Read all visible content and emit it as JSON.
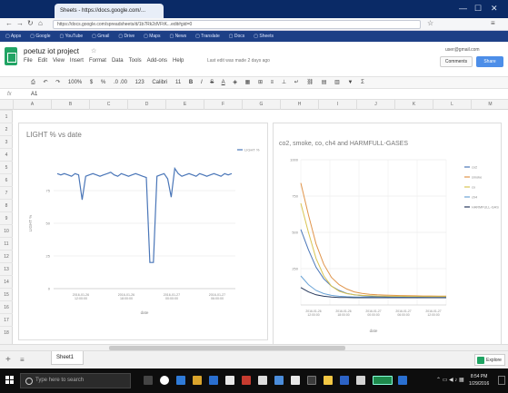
{
  "browser": {
    "tab_title": "Sheets - https://docs.google.com/...",
    "url": "https://docs.google.com/spreadsheets/d/1b7Rk2dVFtK...edit#gid=0",
    "bookmarks": [
      "Apps",
      "Google",
      "YouTube",
      "Gmail",
      "Drive",
      "Maps",
      "News",
      "Translate",
      "Docs",
      "Sheets"
    ],
    "window_controls": [
      "—",
      "☐",
      "✕"
    ]
  },
  "sheets": {
    "doc_title": "poetuz iot project",
    "star_icon": "star-icon",
    "menu": [
      "File",
      "Edit",
      "View",
      "Insert",
      "Format",
      "Data",
      "Tools",
      "Add-ons",
      "Help"
    ],
    "last_edit": "Last edit was made 2 days ago",
    "account": "user@gmail.com",
    "comments_label": "Comments",
    "share_label": "Share",
    "toolbar": {
      "zoom": "100%",
      "currency": "$",
      "percent": "%",
      "decimals": ".0  .00",
      "number_format": "123",
      "font": "Calibri",
      "font_size": "11",
      "bold": "B",
      "italic": "I",
      "strike": "S",
      "text_color": "A"
    },
    "fx_label": "fx",
    "cell_ref": "A1",
    "columns": [
      "A",
      "B",
      "C",
      "D",
      "E",
      "F",
      "G",
      "H",
      "I",
      "J",
      "K",
      "L",
      "M"
    ],
    "rows": [
      "1",
      "2",
      "3",
      "4",
      "5",
      "6",
      "7",
      "8",
      "9",
      "10",
      "11",
      "12",
      "13",
      "14",
      "15",
      "16",
      "17",
      "18"
    ],
    "sheet_tab": "Sheet1",
    "explore_label": "Explore",
    "add_sheet_icon": "plus-icon",
    "list_sheets_icon": "menu-icon"
  },
  "chart_data": [
    {
      "type": "line",
      "title": "LIGHT % vs date",
      "xlabel": "date",
      "ylabel": "LIGHT %",
      "legend": [
        "LIGHT %"
      ],
      "legend_position": "right",
      "yticks": [
        "75",
        "50",
        "25",
        "0"
      ],
      "ylim": [
        0,
        100
      ],
      "xticks": [
        "2016-01-26 12:00:00",
        "2016-01-26 18:00:00",
        "2016-01-27 00:00:00",
        "2016-01-27 06:00:00"
      ],
      "series": [
        {
          "name": "LIGHT %",
          "color": "#4a76b8",
          "x_index": [
            0,
            1,
            2,
            3,
            4,
            5,
            6,
            7,
            8,
            9,
            10,
            11,
            12,
            13,
            14,
            15,
            16,
            17,
            18,
            19,
            20,
            21,
            22,
            23,
            24,
            25,
            26,
            27,
            28,
            29,
            30,
            31,
            32,
            33,
            34,
            35,
            36,
            37,
            38,
            39,
            40,
            41,
            42,
            43,
            44,
            45,
            46,
            47,
            48,
            49
          ],
          "values": [
            88,
            87,
            88,
            87,
            86,
            88,
            87,
            68,
            86,
            87,
            88,
            87,
            86,
            87,
            88,
            89,
            87,
            86,
            88,
            87,
            86,
            87,
            88,
            87,
            86,
            85,
            20,
            20,
            86,
            87,
            88,
            84,
            70,
            92,
            88,
            86,
            87,
            88,
            87,
            86,
            88,
            87,
            86,
            87,
            88,
            87,
            86,
            88,
            87,
            88
          ]
        }
      ]
    },
    {
      "type": "line",
      "title": "co2, smoke, co, ch4 and HARMFULL-GASES",
      "xlabel": "date",
      "ylabel": "",
      "legend": [
        "co2",
        "smoke",
        "co",
        "ch4",
        "HARMFULL-GAS"
      ],
      "legend_position": "right",
      "yticks": [
        "1000",
        "750",
        "500",
        "250"
      ],
      "ylim": [
        0,
        1000
      ],
      "xticks": [
        "2016-01-26 12:00:00",
        "2016-01-26 18:00:00",
        "2016-01-27 00:00:00",
        "2016-01-27 06:00:00",
        "2016-01-27 12:00:00"
      ],
      "series": [
        {
          "name": "co2",
          "color": "#4a76b8",
          "values": [
            520,
            380,
            260,
            180,
            130,
            100,
            80,
            70,
            64,
            60,
            58,
            56,
            55,
            54,
            54,
            53,
            53,
            52,
            52,
            52
          ]
        },
        {
          "name": "smoke",
          "color": "#e0944a",
          "values": [
            840,
            620,
            420,
            280,
            190,
            140,
            110,
            90,
            80,
            74,
            70,
            68,
            66,
            65,
            64,
            63,
            62,
            62,
            61,
            61
          ]
        },
        {
          "name": "co",
          "color": "#d9c452",
          "values": [
            700,
            500,
            320,
            200,
            130,
            95,
            78,
            70,
            66,
            64,
            62,
            61,
            60,
            60,
            59,
            59,
            58,
            58,
            58,
            58
          ]
        },
        {
          "name": "ch4",
          "color": "#6aa3d6",
          "values": [
            200,
            140,
            100,
            78,
            66,
            60,
            57,
            55,
            54,
            53,
            53,
            52,
            52,
            52,
            51,
            51,
            51,
            51,
            51,
            51
          ]
        },
        {
          "name": "HARMFULL-GAS",
          "color": "#27395c",
          "values": [
            120,
            90,
            70,
            60,
            55,
            52,
            51,
            50,
            50,
            50,
            50,
            50,
            50,
            50,
            50,
            50,
            50,
            50,
            50,
            50
          ]
        }
      ]
    }
  ],
  "taskbar": {
    "search_placeholder": "Type here to search",
    "time": "8:54 PM",
    "date": "1/29/2016"
  }
}
